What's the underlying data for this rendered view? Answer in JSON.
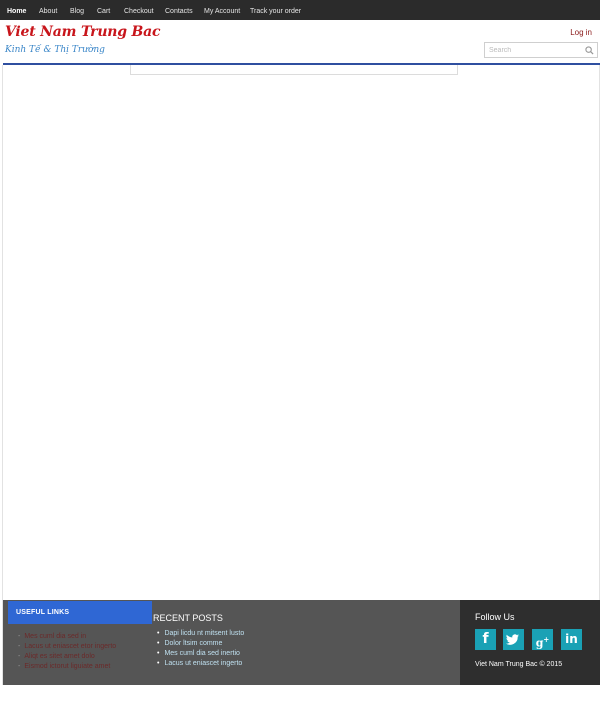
{
  "nav": {
    "items": [
      "Home",
      "About",
      "Blog",
      "Cart",
      "Checkout",
      "Contacts",
      "My Account",
      "Track your order"
    ]
  },
  "header": {
    "brand": "Viet Nam Trung Bac",
    "tagline": "Kinh Tế & Thị Trường",
    "login": "Log in",
    "search_placeholder": "Search"
  },
  "footer": {
    "useful_links": {
      "title": "USEFUL LINKS",
      "items": [
        "Mes cuml dia sed in",
        "Lacus ut eniascet etor ingerto",
        "Aliqt es sitet amet dolo",
        "Eismod ictorut liguiate amet"
      ]
    },
    "recent_posts": {
      "title": "RECENT POSTS",
      "items": [
        "Dapi licdu nt mitsent lusto",
        "Dolor ltsim comme",
        "Mes cuml dia sed inertio",
        "Lacus ut eniascet ingerto"
      ]
    },
    "follow": {
      "title": "Follow Us",
      "icons": [
        "facebook-icon",
        "twitter-icon",
        "google-plus-icon",
        "linkedin-icon"
      ],
      "copyright": "Viet Nam Trung Bac © 2015"
    }
  },
  "colors": {
    "nav_bg": "#2b2b2b",
    "brand_red": "#c8151b",
    "tagline_blue": "#3a86c8",
    "footer_bg": "#555555",
    "footer_dark": "#2e2e2e",
    "useful_head_blue": "#2f67d4",
    "social_teal": "#1aa1b5"
  }
}
